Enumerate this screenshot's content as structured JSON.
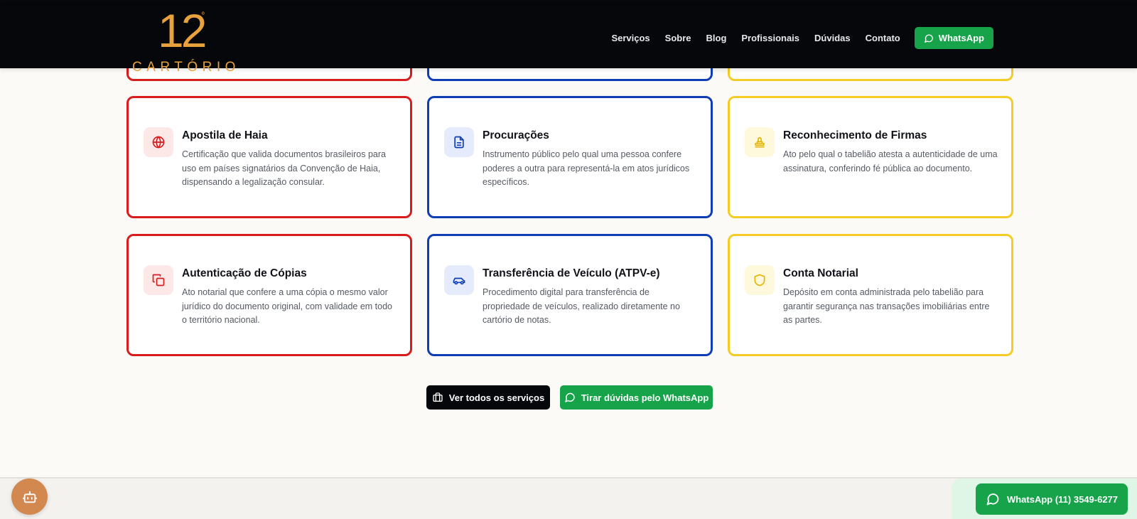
{
  "header": {
    "logo_number": "12",
    "logo_degree": "º",
    "logo_word": "CARTÓRIO",
    "nav": [
      "Serviços",
      "Sobre",
      "Blog",
      "Profissionais",
      "Dúvidas",
      "Contato"
    ],
    "whatsapp_label": "WhatsApp"
  },
  "colors": {
    "red": "#d81b1b",
    "blue": "#0f3db5",
    "yellow": "#f5cc26",
    "green": "#16a34a",
    "black": "#05070b",
    "logo_gold": "#e9a23b"
  },
  "cards": [
    {
      "title": "Apostila de Haia",
      "description": "Certificação que valida documentos brasileiros para uso em países signatários da Convenção de Haia, dispensando a legalização consular.",
      "icon": "globe-icon",
      "accent": "red"
    },
    {
      "title": "Procurações",
      "description": "Instrumento público pelo qual uma pessoa confere poderes a outra para representá-la em atos jurídicos específicos.",
      "icon": "document-icon",
      "accent": "blue"
    },
    {
      "title": "Reconhecimento de Firmas",
      "description": "Ato pelo qual o tabelião atesta a autenticidade de uma assinatura, conferindo fé pública ao documento.",
      "icon": "stamp-icon",
      "accent": "yellow"
    },
    {
      "title": "Autenticação de Cópias",
      "description": "Ato notarial que confere a uma cópia o mesmo valor jurídico do documento original, com validade em todo o território nacional.",
      "icon": "copy-icon",
      "accent": "red"
    },
    {
      "title": "Transferência de Veículo (ATPV-e)",
      "description": "Procedimento digital para transferência de propriedade de veículos, realizado diretamente no cartório de notas.",
      "icon": "car-icon",
      "accent": "blue"
    },
    {
      "title": "Conta Notarial",
      "description": "Depósito em conta administrada pelo tabelião para garantir segurança nas transações imobiliárias entre as partes.",
      "icon": "shield-icon",
      "accent": "yellow"
    }
  ],
  "actions": {
    "all_services": "Ver todos os serviços",
    "whatsapp_doubts": "Tirar dúvidas pelo WhatsApp"
  },
  "floating": {
    "whatsapp_phone": "WhatsApp (11) 3549-6277",
    "assistant_icon": "bot-icon"
  }
}
